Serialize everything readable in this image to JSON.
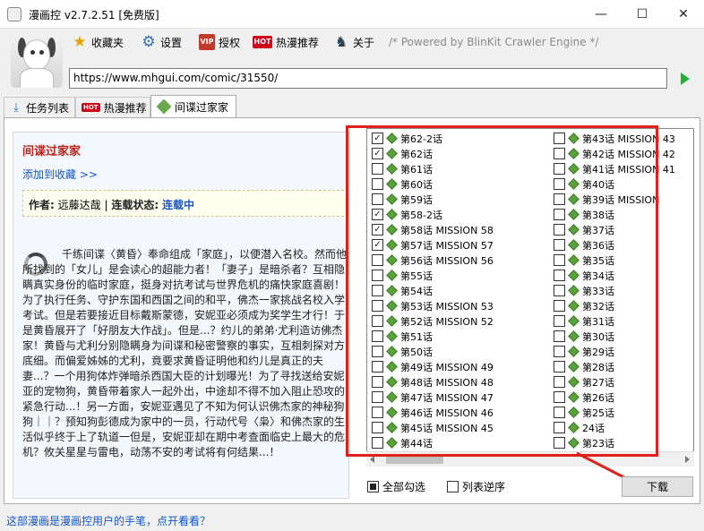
{
  "window": {
    "title": "漫画控 v2.7.2.51 [免费版]",
    "minimize_glyph": "—",
    "maximize_glyph": "☐",
    "close_glyph": "✕"
  },
  "toolbar": {
    "favorites_label": "收藏夹",
    "settings_label": "设置",
    "authorize_label": "授权",
    "vip_badge": "VIP",
    "hot_badge": "HOT",
    "hot_label": "热漫推荐",
    "about_label": "关于",
    "powered_by": "/* Powered by BlinKit Crawler Engine */"
  },
  "url": {
    "value": "https://www.mhgui.com/comic/31550/"
  },
  "tabs": [
    {
      "label": "任务列表"
    },
    {
      "label": "热漫推荐",
      "badge": "HOT"
    },
    {
      "label": "间谍过家家"
    }
  ],
  "comic": {
    "title": "间谍过家家",
    "add_favorite": "添加到收藏 >>",
    "author_label": "作者:",
    "author": "远藤达哉",
    "status_label": "连载状态:",
    "status": "连载中",
    "separator": "|",
    "description": "千练间谍〈黄昏〉奉命组成「家庭」，以便潜入名校。然而他所找到的「女儿」是会读心的超能力者！「妻子」是暗杀者？互相隐瞒真实身份的临时家庭，挺身对抗考试与世界危机的痛快家庭喜剧！为了执行任务、守护东国和西国之间的和平，佛杰一家挑战名校入学考试。但是若要接近目标戴斯蒙德，安妮亚必须成为奖学生才行！于是黄昏展开了「好朋友大作战」。但是...？约儿的弟弟·尤利造访佛杰家！黄昏与尤利分别隐瞒身为间谍和秘密警察的事实，互相刺探对方底细。而偏爱姊姊的尤利，竟要求黄昏证明他和约儿是真正的夫妻...？一个用狗体炸弹暗杀西国大臣的计划曝光！为了寻找送给安妮亚的宠物狗，黄昏带着家人一起外出，中途却不得不加入阻止恐攻的紧急行动...！另一方面，安妮亚遇见了不知为何认识佛杰家的神秘狗狗｜｜？预知狗彭德成为家中的一员，行动代号〈枭〉和佛杰家的生活似乎终于上了轨道一但是，安妮亚却在期中考查面临史上最大的危机？攸关星星与雷电，动荡不安的考试将有何结果...！"
  },
  "chapters_left": [
    {
      "label": "第62-2话",
      "checked": true
    },
    {
      "label": "第62话",
      "checked": true
    },
    {
      "label": "第61话",
      "checked": false
    },
    {
      "label": "第60话",
      "checked": false
    },
    {
      "label": "第59话",
      "checked": false
    },
    {
      "label": "第58-2话",
      "checked": true
    },
    {
      "label": "第58话 MISSION 58",
      "checked": true
    },
    {
      "label": "第57话 MISSION 57",
      "checked": true
    },
    {
      "label": "第56话 MISSION 56",
      "checked": false
    },
    {
      "label": "第55话",
      "checked": false
    },
    {
      "label": "第54话",
      "checked": false
    },
    {
      "label": "第53话 MISSION 53",
      "checked": false
    },
    {
      "label": "第52话 MISSION 52",
      "checked": false
    },
    {
      "label": "第51话",
      "checked": false
    },
    {
      "label": "第50话",
      "checked": false
    },
    {
      "label": "第49话 MISSION 49",
      "checked": false
    },
    {
      "label": "第48话 MISSION 48",
      "checked": false
    },
    {
      "label": "第47话 MISSION 47",
      "checked": false
    },
    {
      "label": "第46话 MISSION 46",
      "checked": false
    },
    {
      "label": "第45话 MISSION 45",
      "checked": false
    },
    {
      "label": "第44话",
      "checked": false
    }
  ],
  "chapters_right": [
    {
      "label": "第43话 MISSION 43",
      "checked": false
    },
    {
      "label": "第42话 MISSION 42",
      "checked": false
    },
    {
      "label": "第41话 MISSION 41",
      "checked": false
    },
    {
      "label": "第40话",
      "checked": false
    },
    {
      "label": "第39话 MISSION",
      "checked": false
    },
    {
      "label": "第38话",
      "checked": false
    },
    {
      "label": "第37话",
      "checked": false
    },
    {
      "label": "第36话",
      "checked": false
    },
    {
      "label": "第35话",
      "checked": false
    },
    {
      "label": "第34话",
      "checked": false
    },
    {
      "label": "第33话",
      "checked": false
    },
    {
      "label": "第32话",
      "checked": false
    },
    {
      "label": "第31话",
      "checked": false
    },
    {
      "label": "第30话",
      "checked": false
    },
    {
      "label": "第29话",
      "checked": false
    },
    {
      "label": "第28话",
      "checked": false
    },
    {
      "label": "第27话",
      "checked": false
    },
    {
      "label": "第26话",
      "checked": false
    },
    {
      "label": "第25话",
      "checked": false
    },
    {
      "label": "24话",
      "checked": false
    },
    {
      "label": "第23话",
      "checked": false
    }
  ],
  "options": {
    "select_all_label": "全部勾选",
    "reverse_label": "列表逆序"
  },
  "download_label": "下载",
  "footer": {
    "link": "这部漫画是漫画控用户的手笔，点开看看？"
  },
  "colors": {
    "highlight_red": "#e0201b",
    "title_red": "#b8241c",
    "link_blue": "#1155cc",
    "chapter_green": "#5aa03c"
  }
}
